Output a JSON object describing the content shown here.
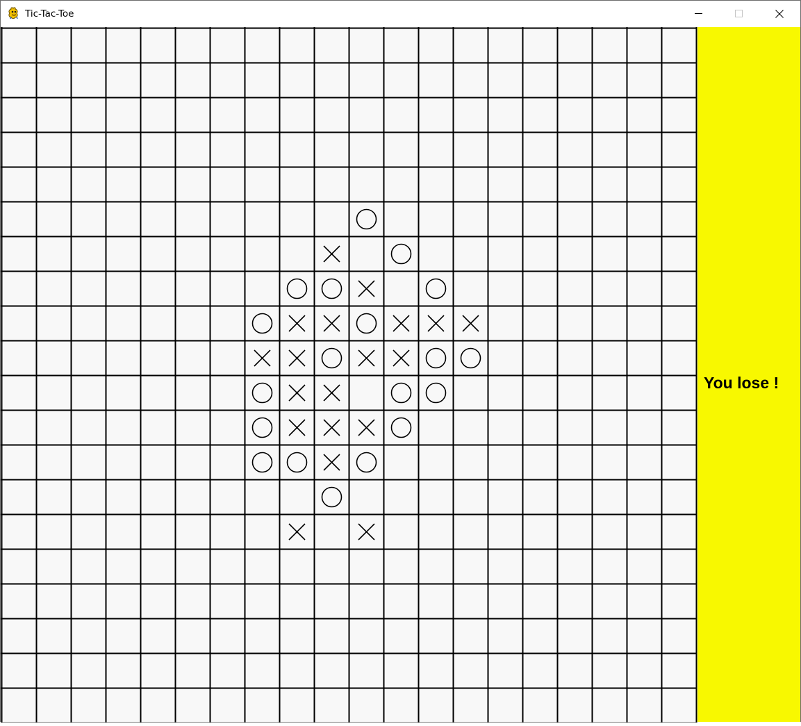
{
  "window": {
    "title": "Tic-Tac-Toe",
    "app_icon": "pygame-snake-icon",
    "controls": [
      {
        "name": "minimize-button",
        "icon": "minimize-icon"
      },
      {
        "name": "maximize-button",
        "icon": "maximize-icon"
      },
      {
        "name": "close-button",
        "icon": "close-icon"
      }
    ]
  },
  "board": {
    "rows": 20,
    "cols": 20,
    "background_color": "#f8f8f8",
    "line_color": "#000000",
    "marks": [
      {
        "row": 5,
        "col": 10,
        "mark": "O"
      },
      {
        "row": 6,
        "col": 9,
        "mark": "X"
      },
      {
        "row": 6,
        "col": 11,
        "mark": "O"
      },
      {
        "row": 7,
        "col": 8,
        "mark": "O"
      },
      {
        "row": 7,
        "col": 9,
        "mark": "O"
      },
      {
        "row": 7,
        "col": 10,
        "mark": "X"
      },
      {
        "row": 7,
        "col": 12,
        "mark": "O"
      },
      {
        "row": 8,
        "col": 7,
        "mark": "O"
      },
      {
        "row": 8,
        "col": 8,
        "mark": "X"
      },
      {
        "row": 8,
        "col": 9,
        "mark": "X"
      },
      {
        "row": 8,
        "col": 10,
        "mark": "O"
      },
      {
        "row": 8,
        "col": 11,
        "mark": "X"
      },
      {
        "row": 8,
        "col": 12,
        "mark": "X"
      },
      {
        "row": 8,
        "col": 13,
        "mark": "X"
      },
      {
        "row": 9,
        "col": 7,
        "mark": "X"
      },
      {
        "row": 9,
        "col": 8,
        "mark": "X"
      },
      {
        "row": 9,
        "col": 9,
        "mark": "O"
      },
      {
        "row": 9,
        "col": 10,
        "mark": "X"
      },
      {
        "row": 9,
        "col": 11,
        "mark": "X"
      },
      {
        "row": 9,
        "col": 12,
        "mark": "O"
      },
      {
        "row": 9,
        "col": 13,
        "mark": "O"
      },
      {
        "row": 10,
        "col": 7,
        "mark": "O"
      },
      {
        "row": 10,
        "col": 8,
        "mark": "X"
      },
      {
        "row": 10,
        "col": 9,
        "mark": "X"
      },
      {
        "row": 10,
        "col": 11,
        "mark": "O"
      },
      {
        "row": 10,
        "col": 12,
        "mark": "O"
      },
      {
        "row": 11,
        "col": 7,
        "mark": "O"
      },
      {
        "row": 11,
        "col": 8,
        "mark": "X"
      },
      {
        "row": 11,
        "col": 9,
        "mark": "X"
      },
      {
        "row": 11,
        "col": 10,
        "mark": "X"
      },
      {
        "row": 11,
        "col": 11,
        "mark": "O"
      },
      {
        "row": 12,
        "col": 7,
        "mark": "O"
      },
      {
        "row": 12,
        "col": 8,
        "mark": "O"
      },
      {
        "row": 12,
        "col": 9,
        "mark": "X"
      },
      {
        "row": 12,
        "col": 10,
        "mark": "O"
      },
      {
        "row": 13,
        "col": 9,
        "mark": "O"
      },
      {
        "row": 14,
        "col": 8,
        "mark": "X"
      },
      {
        "row": 14,
        "col": 10,
        "mark": "X"
      }
    ]
  },
  "side_panel": {
    "background_color": "#f8f800",
    "status": "You lose !"
  }
}
